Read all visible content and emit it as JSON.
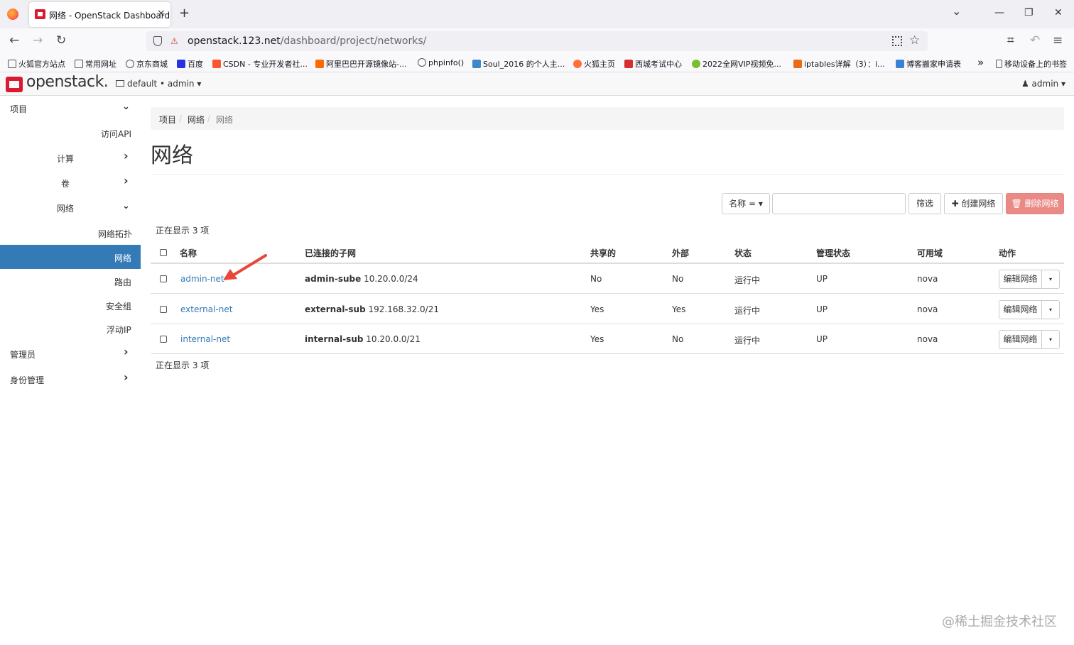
{
  "browser": {
    "tab_title": "网络 - OpenStack Dashboard",
    "tab_close": "×",
    "new_tab": "+",
    "url_host": "openstack.123.net",
    "url_path": "/dashboard/project/networks/",
    "back": "←",
    "forward": "→",
    "reload": "↻",
    "tab_list": "⌄",
    "minimize": "—",
    "restore": "❐",
    "close": "✕",
    "crop_icon": "⌗",
    "undo_icon": "↶",
    "menu_icon": "≡",
    "bookmarks": [
      {
        "label": "火狐官方站点",
        "color": "#ffffff"
      },
      {
        "label": "常用网址",
        "color": "#ffffff"
      },
      {
        "label": "京东商城",
        "color": "#ffffff"
      },
      {
        "label": "百度",
        "color": "#2932e1"
      },
      {
        "label": "CSDN - 专业开发者社...",
        "color": "#fc5531"
      },
      {
        "label": "阿里巴巴开源镜像站-...",
        "color": "#ff6a00"
      },
      {
        "label": "phpinfo()",
        "color": "#ffffff"
      },
      {
        "label": "Soul_2016 的个人主...",
        "color": "#3f88c5"
      },
      {
        "label": "火狐主页",
        "color": "#ff7139"
      },
      {
        "label": "西城考试中心",
        "color": "#d62f2f"
      },
      {
        "label": "2022全网VIP视频免...",
        "color": "#7bbf2e"
      },
      {
        "label": "iptables详解（3）：i...",
        "color": "#e96b14"
      },
      {
        "label": "博客搬家申请表",
        "color": "#3b82d6"
      }
    ],
    "bookmarks_more": "»",
    "mobile_bookmarks": "移动设备上的书签"
  },
  "header": {
    "logo": "openstack.",
    "project": "default • admin",
    "project_caret": "▾",
    "user": "admin",
    "user_icon": "♟",
    "user_caret": "▾"
  },
  "sidebar": {
    "items": [
      {
        "label": "项目",
        "chevron": "⌄"
      },
      {
        "label": "访问API",
        "chevron": ""
      },
      {
        "label": "计算",
        "chevron": "›"
      },
      {
        "label": "卷",
        "chevron": "›"
      },
      {
        "label": "网络",
        "chevron": "⌄"
      },
      {
        "label": "网络拓扑",
        "chevron": ""
      },
      {
        "label": "网络",
        "chevron": ""
      },
      {
        "label": "路由",
        "chevron": ""
      },
      {
        "label": "安全组",
        "chevron": ""
      },
      {
        "label": "浮动IP",
        "chevron": ""
      },
      {
        "label": "管理员",
        "chevron": "›"
      },
      {
        "label": "身份管理",
        "chevron": "›"
      }
    ]
  },
  "breadcrumb": {
    "items": [
      "项目",
      "网络",
      "网络"
    ],
    "sep": "/"
  },
  "page_title": "网络",
  "toolbar": {
    "filter_field": "名称 = ▾",
    "filter_button": "筛选",
    "create_button": "✚ 创建网络",
    "delete_button": "🗑 删除网络"
  },
  "count_text": "正在显示 3 项",
  "table": {
    "headers": [
      "名称",
      "已连接的子网",
      "共享的",
      "外部",
      "状态",
      "管理状态",
      "可用域",
      "动作"
    ],
    "rows": [
      {
        "name": "admin-net",
        "subnet_name": "admin-sube",
        "subnet_cidr": "10.20.0.0/24",
        "shared": "No",
        "external": "No",
        "status": "运行中",
        "admin_state": "UP",
        "az": "nova",
        "action": "编辑网络",
        "caret": "▾"
      },
      {
        "name": "external-net",
        "subnet_name": "external-sub",
        "subnet_cidr": "192.168.32.0/21",
        "shared": "Yes",
        "external": "Yes",
        "status": "运行中",
        "admin_state": "UP",
        "az": "nova",
        "action": "编辑网络",
        "caret": "▾"
      },
      {
        "name": "internal-net",
        "subnet_name": "internal-sub",
        "subnet_cidr": "10.20.0.0/21",
        "shared": "Yes",
        "external": "No",
        "status": "运行中",
        "admin_state": "UP",
        "az": "nova",
        "action": "编辑网络",
        "caret": "▾"
      }
    ]
  },
  "watermark": "@稀土掘金技术社区",
  "colors": {
    "accent": "#337ab7",
    "danger": "#e98a86",
    "brand": "#da1a32",
    "arrow": "#e8473b"
  }
}
